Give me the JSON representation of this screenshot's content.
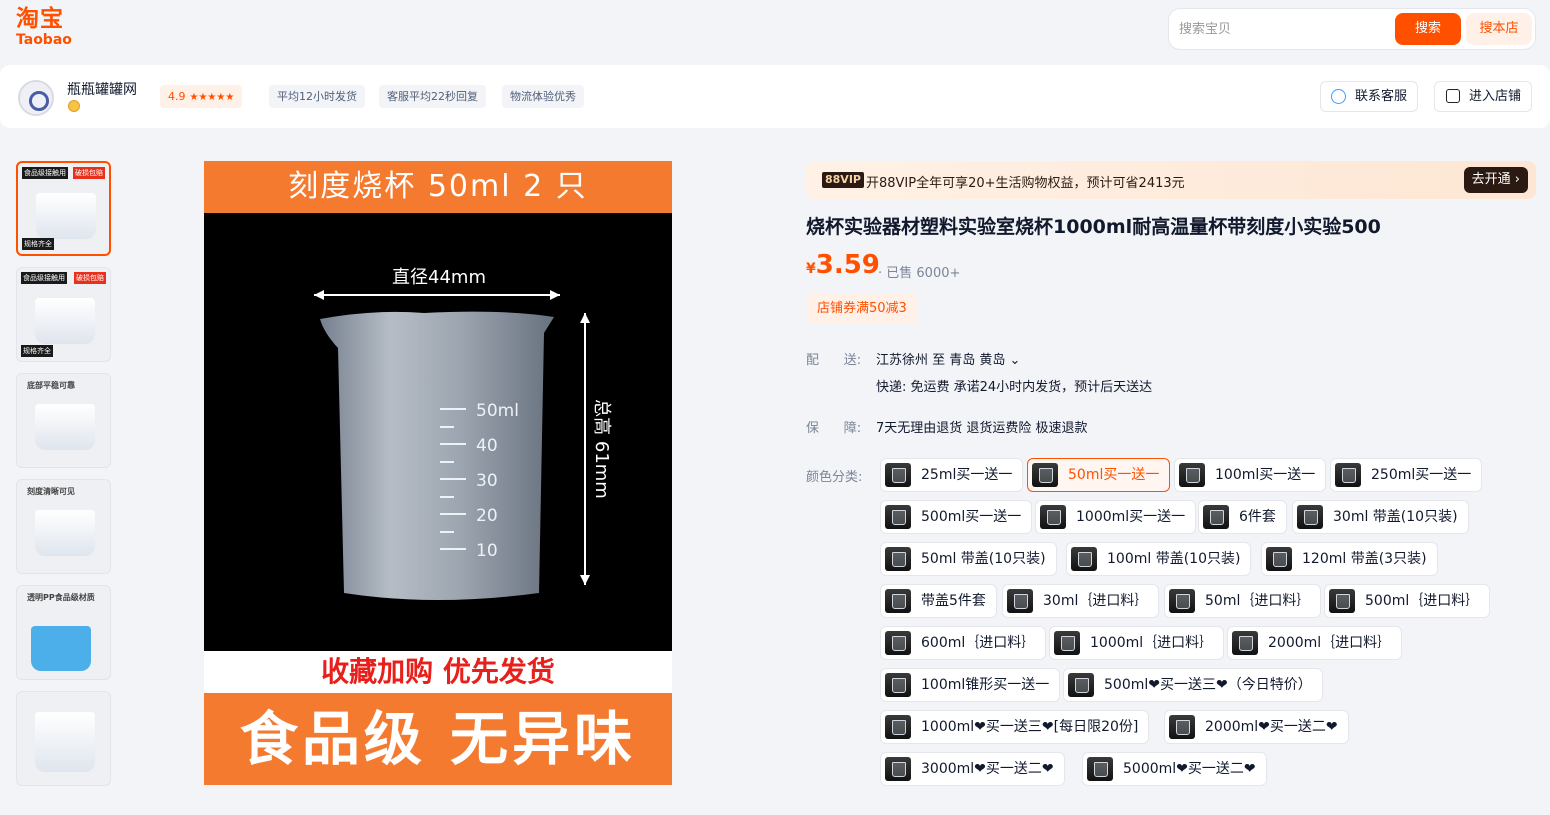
{
  "header": {
    "logo_cn": "淘宝",
    "logo_en": "Taobao",
    "search_placeholder": "搜索宝贝",
    "search_button": "搜索",
    "shop_search_button": "搜本店"
  },
  "shop": {
    "name": "瓶瓶罐罐网",
    "rating": "4.9",
    "stars": "★★★★★",
    "tags": [
      "平均12小时发货",
      "客服平均22秒回复",
      "物流体验优秀"
    ],
    "contact_label": "联系客服",
    "enter_label": "进入店铺"
  },
  "gallery": {
    "banner_top": "刻度烧杯  50ml  2 只",
    "diameter_label": "直径44mm",
    "height_label": "总高 61mm",
    "scale_labels": [
      "50ml",
      "40",
      "30",
      "20",
      "10"
    ],
    "mid_text": "收藏加购 优先发货",
    "banner_bottom": "食品级 无异味",
    "thumbs": [
      {
        "t1": "食品级接触用",
        "t2": "破损包赔",
        "t3": "规格齐全"
      },
      {
        "t1": "食品级接触用",
        "t2": "破损包赔",
        "t3": "规格齐全"
      },
      {
        "label": "底部平稳可靠"
      },
      {
        "label": "刻度清晰可见"
      },
      {
        "label": "透明PP食品级材质"
      },
      {
        "label": ""
      }
    ]
  },
  "vip": {
    "badge": "88VIP",
    "text": "开88VIP全年可享20+生活购物权益，预计可省2413元",
    "button": "去开通 ›"
  },
  "product": {
    "title": "烧杯实验器材塑料实验室烧杯1000ml耐高温量杯带刻度小实验500",
    "currency": "¥",
    "price": "3.59",
    "sold": "· 已售 6000+",
    "coupon": "店铺券满50减3"
  },
  "delivery": {
    "label": "配      送:",
    "route": "江苏徐州  至  青岛 黄岛 ⌄",
    "detail": "快递: 免运费  承诺24小时内发货，预计后天送达"
  },
  "guarantee": {
    "label": "保      障:",
    "value": "7天无理由退货 退货运费险 极速退款"
  },
  "sku": {
    "label": "颜色分类:",
    "selected": "50ml买一送一",
    "options": [
      "25ml买一送一",
      "50ml买一送一",
      "100ml买一送一",
      "250ml买一送一",
      "500ml买一送一",
      "1000ml买一送一",
      "6件套",
      "30ml 带盖(10只装)",
      "50ml 带盖(10只装)",
      "100ml 带盖(10只装)",
      "120ml 带盖(3只装)",
      "带盖5件套",
      "30ml｛进口料｝",
      "50ml｛进口料｝",
      "500ml｛进口料｝",
      "600ml｛进口料｝",
      "1000ml｛进口料｝",
      "2000ml｛进口料｝",
      "100ml锥形买一送一",
      "500ml❤买一送三❤（今日特价）",
      "1000ml❤买一送三❤[每日限20份]",
      "2000ml❤买一送二❤",
      "3000ml❤买一送二❤",
      "5000ml❤买一送二❤"
    ]
  }
}
